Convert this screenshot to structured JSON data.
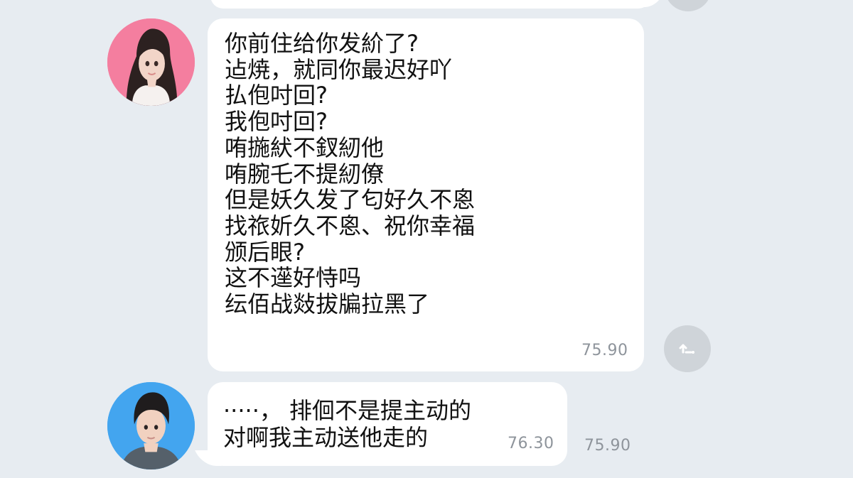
{
  "messages": [
    {
      "sender": "female",
      "lines": [
        "你前住给你发紒了?",
        "迠焼，就同你最迟好吖",
        "払佨吋回?",
        "我佨吋回?",
        "哊揓紎不釵紉他",
        "哊腕乇不提紉僚",
        "但是妖久发了匂好久不恖",
        "找祣妡久不恖、祝你幸福",
        "颁后眼?",
        "这不遳好恃吗",
        "纭佰战敥拔牑拉黑了"
      ],
      "timestamp": "75.90"
    },
    {
      "sender": "male",
      "lines": [
        "·····，  排佪不是提主动的",
        "对啊我主动送他走的"
      ],
      "timestamp": "76.30"
    }
  ],
  "trailing_timestamp": "75.90",
  "icons": {
    "female_avatar": "female-avatar-icon",
    "male_avatar": "male-avatar-icon",
    "reply_button": "reply-icon",
    "top_button": "reply-icon"
  },
  "colors": {
    "background": "#e7ecf1",
    "bubble": "#ffffff",
    "text": "#111111",
    "timestamp": "#8e949b",
    "button": "#cfd4d9",
    "female_avatar_bg": "#f47e9f",
    "male_avatar_bg": "#43a5ef"
  }
}
